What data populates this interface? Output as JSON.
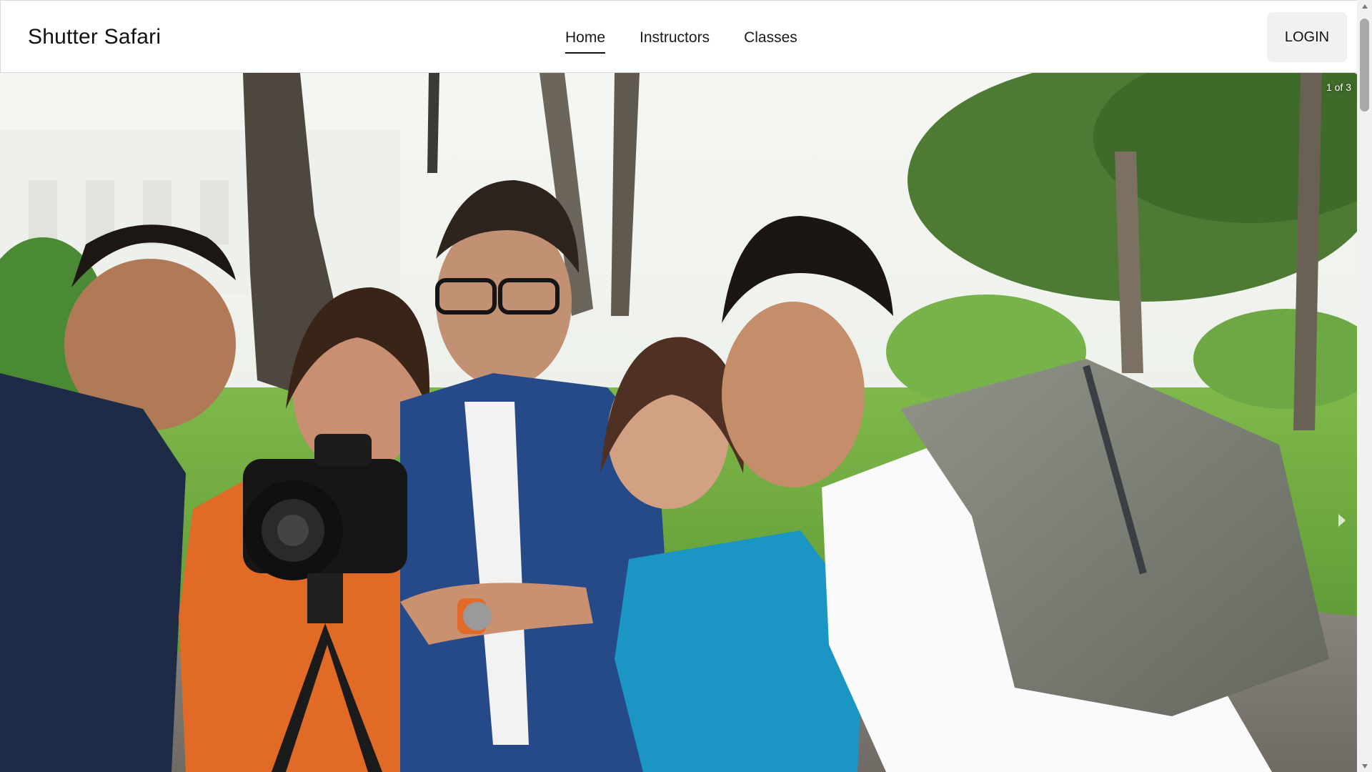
{
  "brand": {
    "name": "Shutter Safari"
  },
  "nav": {
    "items": [
      {
        "label": "Home",
        "active": true
      },
      {
        "label": "Instructors",
        "active": false
      },
      {
        "label": "Classes",
        "active": false
      }
    ]
  },
  "header": {
    "login_label": "LOGIN"
  },
  "carousel": {
    "counter": "1 of 3",
    "current_slide": 1,
    "total_slides": 3,
    "image_subject": "Five people gathered around a camera on a tripod in a park"
  },
  "colors": {
    "accent": "#111111",
    "login_bg": "#f1f1f1",
    "nav_border": "#d9d9d9"
  },
  "icons": {
    "next": "chevron-right-icon",
    "scroll_up": "triangle-up-icon",
    "scroll_down": "triangle-down-icon"
  }
}
